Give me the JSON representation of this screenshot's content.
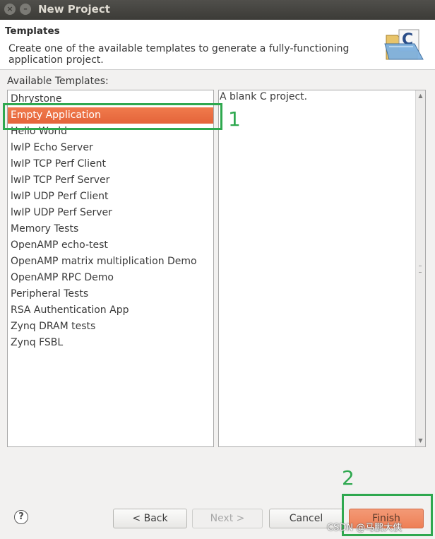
{
  "window": {
    "title": "New Project",
    "close_glyph": "×",
    "min_glyph": "–"
  },
  "header": {
    "title": "Templates",
    "description": "Create one of the available templates to generate a fully-functioning application project.",
    "icon": "c-project-folder-icon",
    "icon_letter": "C"
  },
  "templates": {
    "label": "Available Templates:",
    "items": [
      "Dhrystone",
      "Empty Application",
      "Hello World",
      "lwIP Echo Server",
      "lwIP TCP Perf Client",
      "lwIP TCP Perf Server",
      "lwIP UDP Perf Client",
      "lwIP UDP Perf Server",
      "Memory Tests",
      "OpenAMP echo-test",
      "OpenAMP matrix multiplication Demo",
      "OpenAMP RPC Demo",
      "Peripheral Tests",
      "RSA Authentication App",
      "Zynq DRAM tests",
      "Zynq FSBL"
    ],
    "selected_index": 1
  },
  "description_pane": {
    "text": "A blank C project."
  },
  "annotations": {
    "one": "1",
    "two": "2",
    "color": "#2fa84f"
  },
  "footer": {
    "help_glyph": "?",
    "back_label": "< Back",
    "next_label": "Next >",
    "cancel_label": "Cancel",
    "finish_label": "Finish"
  },
  "watermark": "CSDN @马鹏大侠",
  "colors": {
    "selection": "#e96a3f",
    "finish": "#ef8460",
    "titlebar": "#3c3b37"
  }
}
